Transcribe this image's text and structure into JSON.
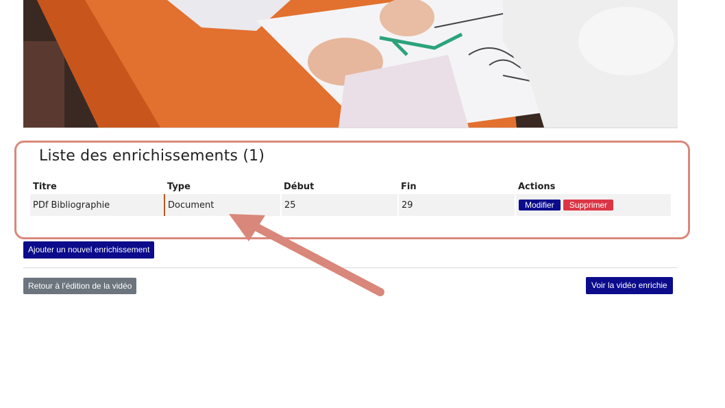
{
  "section": {
    "title": "Liste des enrichissements (1)"
  },
  "table": {
    "headers": {
      "title": "Titre",
      "type": "Type",
      "start": "Début",
      "end": "Fin",
      "actions": "Actions"
    },
    "rows": [
      {
        "title": "PDf Bibliographie",
        "type": "Document",
        "start": "25",
        "end": "29",
        "edit_label": "Modifier",
        "delete_label": "Supprimer"
      }
    ]
  },
  "buttons": {
    "add": "Ajouter un nouvel enrichissement",
    "back": "Retour à l’édition de la vidéo",
    "view": "Voir la vidéo enrichie"
  },
  "colors": {
    "primary": "#0b0b8c",
    "danger": "#dc3545",
    "secondary": "#6c757d",
    "highlight": "#d9877a"
  }
}
